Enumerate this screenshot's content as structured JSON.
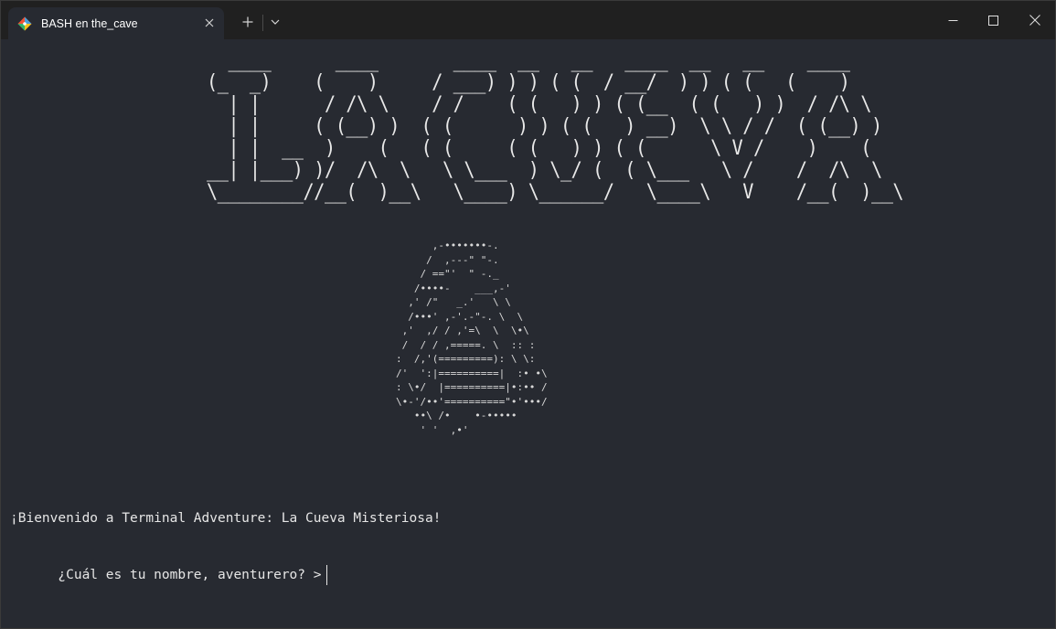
{
  "window": {
    "tab_title": "BASH en the_cave",
    "new_tab_label": "+",
    "dropdown_label": "⌄",
    "minimize_label": "—",
    "maximize_label": "□",
    "close_label": "✕",
    "tab_close_label": "✕"
  },
  "colors": {
    "terminal_bg": "#272a31",
    "titlebar_bg": "#202020",
    "text": "#e6e6e6"
  },
  "terminal": {
    "title_art": "  ____      ____       ____  __   __   ____  __   __    ____\n(_  _)    (    )     / ___) ) ) ( (  / __/  ) ) ( (   (    )\n  | |      / /\\ \\    / /    ( (   ) ) ( (__  ( (   ) )  / /\\ \\\n  | |     ( (__) )  ( (      ) ) ( (   ) __)  \\ \\ / /  ( (__) )\n  | |  __  )    (   ( (     ( (   ) ) ( (      \\ V /    )    (\n__| |___) )/  /\\  \\   \\ \\___  ) \\_/ (  ( \\___   \\ /    /  /\\  \\\n\\________//__(  )__\\   \\____) \\______/   \\____\\   V    /__(  )__\\",
    "cave_art": "      ,-•••••••-.\n     /  ,---\" \"-.\n    / ==\"'  \" -._\n   /••••-    ___,-'\n  ,' /\"   _.'   \\ \\\n  /•••' ,-'.-\"-. \\  \\\n ,'  ,/ / ,'=\\  \\  \\•\\\n /  / / ,=====. \\  :: :\n:  /,'(=========): \\ \\:\n/'  ':|==========|  :• •\\\n: \\•/  |==========|•:•• /\n\\•-'/••'==========\"•'•••/\n   ••\\ /•    •-•••••\n    ' '  ,•'",
    "welcome": "¡Bienvenido a Terminal Adventure: La Cueva Misteriosa!",
    "prompt": "¿Cuál es tu nombre, aventurero? >"
  }
}
